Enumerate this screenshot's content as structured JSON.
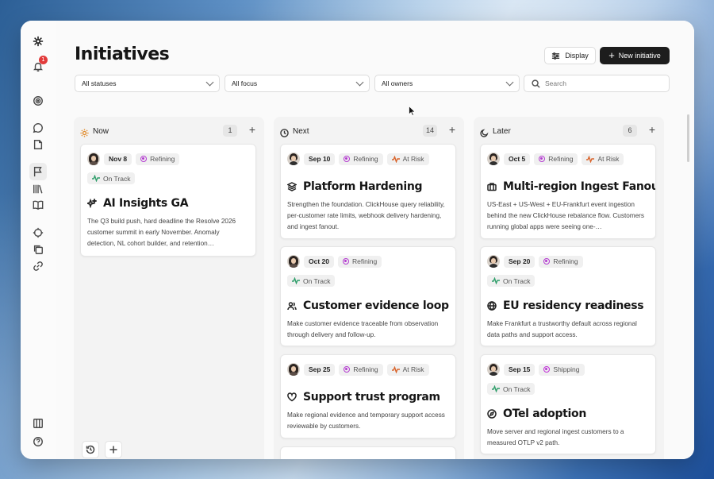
{
  "page": {
    "title": "Initiatives"
  },
  "toolbar": {
    "display_label": "Display",
    "new_label": "New initiative"
  },
  "sidebar": {
    "notification_count": "1"
  },
  "filters": {
    "status": "All statuses",
    "focus": "All focus",
    "owners": "All owners",
    "search_placeholder": "Search"
  },
  "columns": [
    {
      "title": "Now",
      "count": "1",
      "cards": [
        {
          "date": "Nov 8",
          "stage": "Refining",
          "health": "On Track",
          "title": "AI Insights GA",
          "desc": "The Q3 build push, hard deadline the Resolve 2026 customer summit in early November. Anomaly detection, NL cohort builder, and retention…"
        }
      ]
    },
    {
      "title": "Next",
      "count": "14",
      "cards": [
        {
          "date": "Sep 10",
          "stage": "Refining",
          "health": "At Risk",
          "title": "Platform Hardening",
          "desc": "Strengthen the foundation. ClickHouse query reliability, per-customer rate limits, webhook delivery hardening, and ingest fanout."
        },
        {
          "date": "Oct 20",
          "stage": "Refining",
          "health": "On Track",
          "title": "Customer evidence loop",
          "desc": "Make customer evidence traceable from observation through delivery and follow-up."
        },
        {
          "date": "Sep 25",
          "stage": "Refining",
          "health": "At Risk",
          "title": "Support trust program",
          "desc": "Make regional evidence and temporary support access reviewable by customers."
        }
      ]
    },
    {
      "title": "Later",
      "count": "6",
      "cards": [
        {
          "date": "Oct 5",
          "stage": "Refining",
          "health": "At Risk",
          "title": "Multi-region Ingest Fanout",
          "desc": "US-East + US-West + EU-Frankfurt event ingestion behind the new ClickHouse rebalance flow. Customers running global apps were seeing one-…"
        },
        {
          "date": "Sep 20",
          "stage": "Refining",
          "health": "On Track",
          "title": "EU residency readiness",
          "desc": "Make Frankfurt a trustworthy default across regional data paths and support access."
        },
        {
          "date": "Sep 15",
          "stage": "Shipping",
          "health": "On Track",
          "title": "OTel adoption",
          "desc": "Move server and regional ingest customers to a measured OTLP v2 path."
        }
      ]
    }
  ],
  "colors": {
    "stage_refining": "#b33bd0",
    "stage_shipping": "#c22fd8",
    "on_track": "#2f9e6a",
    "at_risk": "#d9642b",
    "now_icon": "#e08a2a",
    "primary_button": "#1d1d1d"
  },
  "icons": {
    "c0_0": "sparkles-icon",
    "c1_0": "layers-icon",
    "c1_1": "users-icon",
    "c1_2": "heart-icon",
    "c2_0": "briefcase-icon",
    "c2_1": "globe-icon",
    "c2_2": "compass-icon"
  }
}
